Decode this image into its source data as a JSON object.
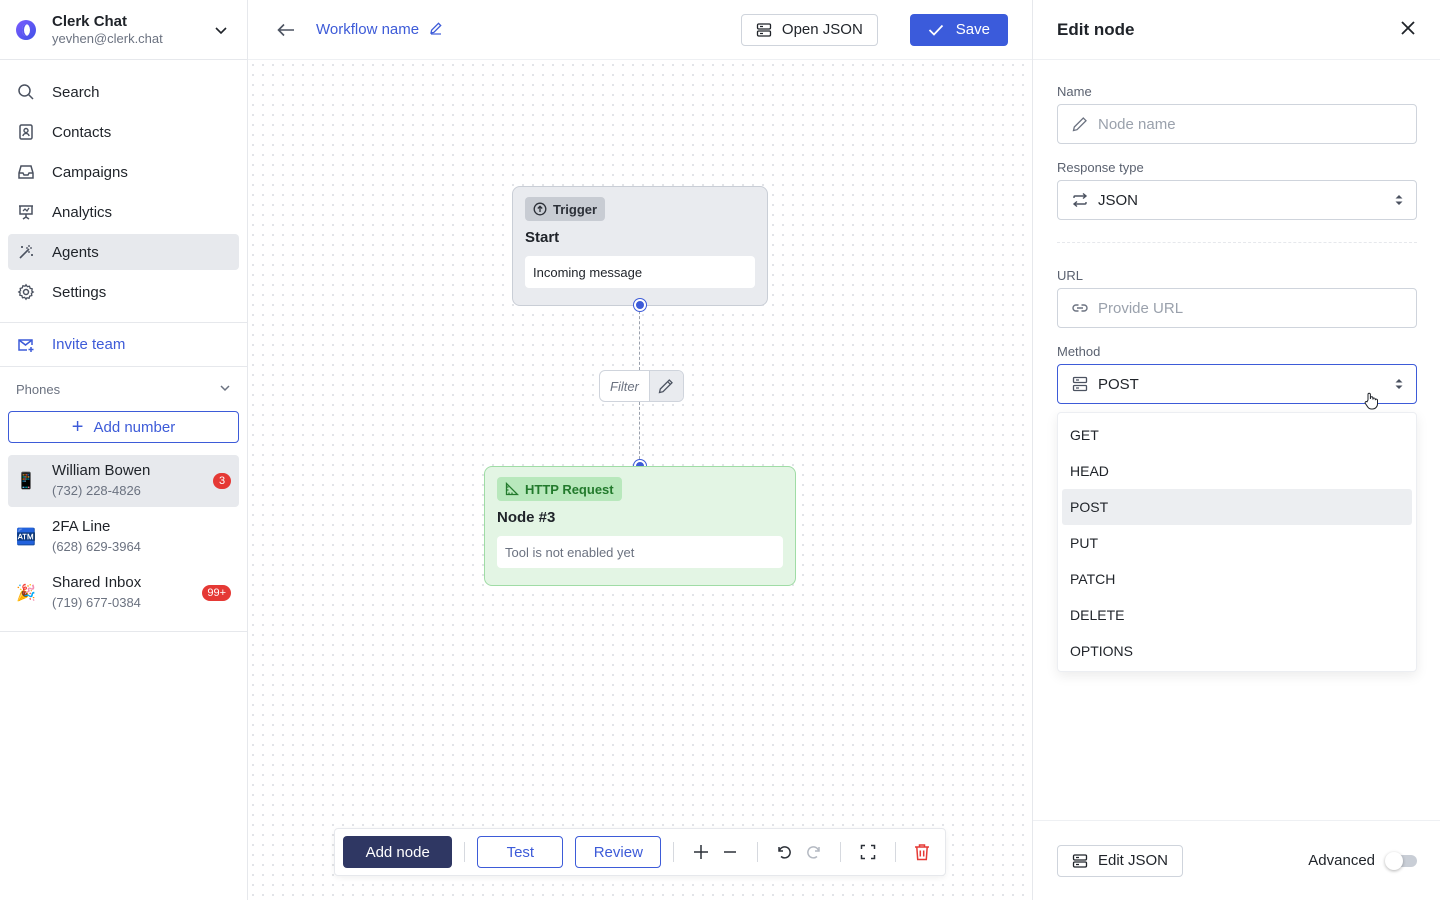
{
  "account": {
    "name": "Clerk Chat",
    "email": "yevhen@clerk.chat"
  },
  "nav": {
    "items": [
      {
        "label": "Search",
        "icon": "search-icon"
      },
      {
        "label": "Contacts",
        "icon": "contacts-icon"
      },
      {
        "label": "Campaigns",
        "icon": "campaigns-icon"
      },
      {
        "label": "Analytics",
        "icon": "analytics-icon"
      },
      {
        "label": "Agents",
        "icon": "agents-icon",
        "active": true
      },
      {
        "label": "Settings",
        "icon": "gear-icon"
      }
    ],
    "invite_label": "Invite team"
  },
  "phones": {
    "heading": "Phones",
    "add_label": "Add number",
    "list": [
      {
        "name": "William Bowen",
        "number": "(732) 228-4826",
        "badge": "3",
        "emoji": "📱"
      },
      {
        "name": "2FA Line",
        "number": "(628) 629-3964",
        "badge": "",
        "emoji": "🏧"
      },
      {
        "name": "Shared Inbox",
        "number": "(719) 677-0384",
        "badge": "99+",
        "emoji": "🎉"
      }
    ]
  },
  "topbar": {
    "workflow_name": "Workflow name",
    "open_json_label": "Open JSON",
    "save_label": "Save"
  },
  "canvas": {
    "trigger_node": {
      "chip": "Trigger",
      "title": "Start",
      "body": "Incoming message"
    },
    "filter_label": "Filter",
    "http_node": {
      "chip": "HTTP Request",
      "title": "Node #3",
      "body": "Tool is not enabled yet"
    }
  },
  "toolbar": {
    "add_node": "Add node",
    "test": "Test",
    "review": "Review"
  },
  "panel": {
    "title": "Edit node",
    "name_label": "Name",
    "name_placeholder": "Node name",
    "response_type_label": "Response type",
    "response_type_value": "JSON",
    "url_label": "URL",
    "url_placeholder": "Provide URL",
    "method_label": "Method",
    "method_value": "POST",
    "method_options": [
      "GET",
      "HEAD",
      "POST",
      "PUT",
      "PATCH",
      "DELETE",
      "OPTIONS"
    ],
    "edit_json_label": "Edit JSON",
    "advanced_label": "Advanced"
  },
  "colors": {
    "accent": "#3b5bdb",
    "dark_button": "#2f3763",
    "badge": "#e53935",
    "http_node_bg": "#e3f5e4"
  }
}
